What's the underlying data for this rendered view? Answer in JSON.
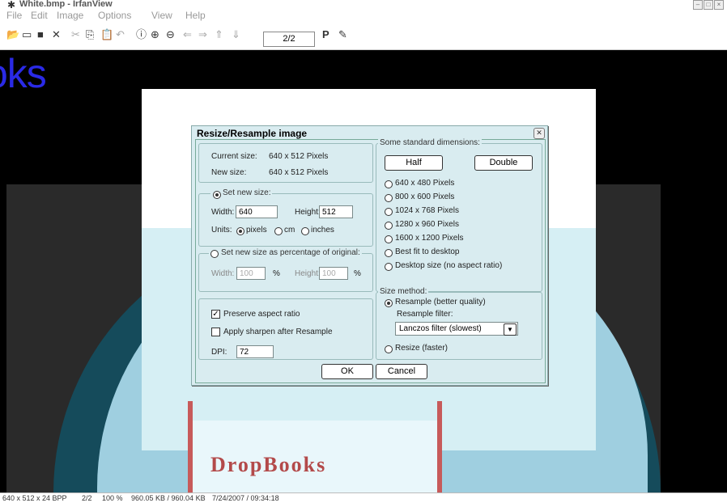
{
  "window": {
    "title": "White.bmp - IrfanView"
  },
  "menu": [
    "File",
    "Edit",
    "Image",
    "Options",
    "View",
    "Help"
  ],
  "toolbar": {
    "page": "2/2",
    "p_label": "P"
  },
  "canvas": {
    "watermark": "oks",
    "brand": "DropBooks"
  },
  "dialog": {
    "title": "Resize/Resample image",
    "current_size_label": "Current size:",
    "current_size_value": "640  x  512  Pixels",
    "new_size_label": "New size:",
    "new_size_value": "640  x  512  Pixels",
    "set_new_size": "Set new size:",
    "width_label": "Width:",
    "width_value": "640",
    "height_label": "Height:",
    "height_value": "512",
    "units_label": "Units:",
    "units": [
      "pixels",
      "cm",
      "inches"
    ],
    "percent_label": "Set new size as percentage of original:",
    "pct_width_label": "Width:",
    "pct_width_value": "100",
    "pct_sign": "%",
    "pct_height_label": "Height:",
    "pct_height_value": "100",
    "preserve_aspect": "Preserve aspect ratio",
    "apply_sharpen": "Apply sharpen after Resample",
    "dpi_label": "DPI:",
    "dpi_value": "72",
    "standard_dims_label": "Some standard dimensions:",
    "half_label": "Half",
    "double_label": "Double",
    "dimension_options": [
      "640 x 480 Pixels",
      "800 x 600 Pixels",
      "1024 x 768 Pixels",
      "1280 x 960 Pixels",
      "1600 x 1200 Pixels",
      "Best fit to desktop",
      "Desktop size (no aspect ratio)"
    ],
    "size_method_label": "Size method:",
    "resample_label": "Resample (better quality)",
    "resample_filter_label": "Resample filter:",
    "resample_filter_value": "Lanczos filter (slowest)",
    "resize_label": "Resize (faster)",
    "ok_label": "OK",
    "cancel_label": "Cancel"
  },
  "status": {
    "dims": "640 x 512 x 24 BPP",
    "page": "2/2",
    "zoom": "100 %",
    "size": "960.05 KB / 960.04 KB",
    "datetime": "7/24/2007 / 09:34:18"
  }
}
